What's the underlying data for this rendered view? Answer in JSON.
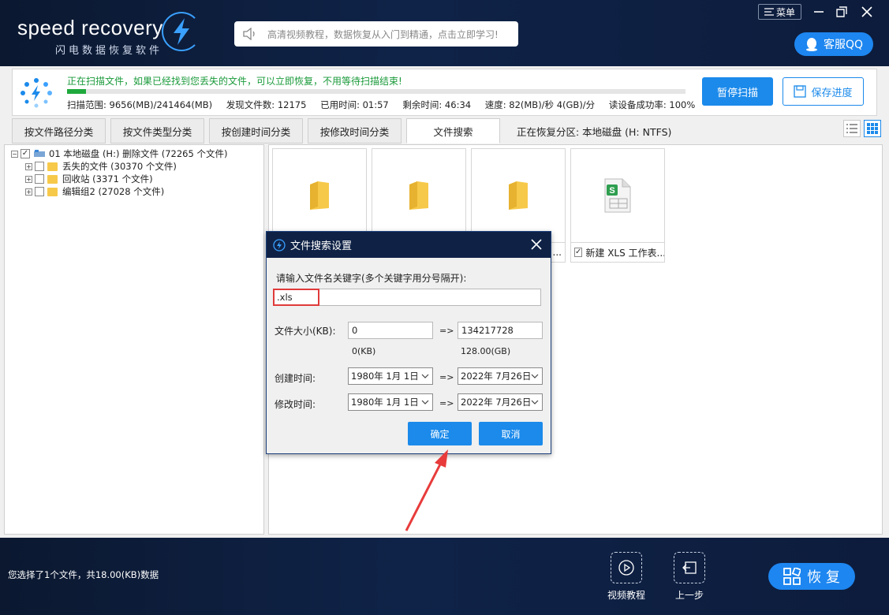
{
  "header": {
    "logo_text": "speed recovery",
    "logo_subtitle": "闪电数据恢复软件",
    "promo_text": "高清视频教程，数据恢复从入门到精通，点击立即学习!",
    "menu_label": "菜单",
    "qq_label": "客服QQ"
  },
  "scan": {
    "status_text": "正在扫描文件，如果已经找到您丢失的文件，可以立即恢复，不用等待扫描结束!",
    "progress_fraction": 0.03,
    "range": "扫描范围: 9656(MB)/241464(MB)",
    "found": "发现文件数: 12175",
    "elapsed": "已用时间: 01:57",
    "remaining": "剩余时间: 46:34",
    "speed": "速度: 82(MB)/秒  4(GB)/分",
    "success_rate": "读设备成功率: 100%",
    "pause_label": "暂停扫描",
    "save_label": "保存进度"
  },
  "tabs": [
    {
      "label": "按文件路径分类",
      "active": false
    },
    {
      "label": "按文件类型分类",
      "active": false
    },
    {
      "label": "按创建时间分类",
      "active": false
    },
    {
      "label": "按修改时间分类",
      "active": false
    },
    {
      "label": "文件搜索",
      "active": true
    }
  ],
  "partition_label": "正在恢复分区: 本地磁盘 (H: NTFS)",
  "tree": {
    "root": "01 本地磁盘 (H:) 删除文件  (72265 个文件)",
    "children": [
      "丢失的文件    (30370 个文件)",
      "回收站    (3371 个文件)",
      "编辑组2    (27028 个文件)"
    ]
  },
  "tiles": [
    {
      "type": "folder-icon",
      "label": ""
    },
    {
      "type": "folder-icon",
      "label": ""
    },
    {
      "type": "folder-icon",
      "label": "..."
    },
    {
      "type": "xls-file-icon",
      "label": "新建 XLS 工作表...",
      "checked": true
    }
  ],
  "dialog": {
    "title": "文件搜索设置",
    "keyword_label": "请输入文件名关键字(多个关键字用分号隔开):",
    "keyword_value": ".xls",
    "size_label": "文件大小(KB):",
    "size_min": "0",
    "size_max": "134217728",
    "size_min_hint": "0(KB)",
    "size_max_hint": "128.00(GB)",
    "arrow": "=>",
    "created_label": "创建时间:",
    "created_from": "1980年  1月  1日",
    "created_to": "2022年  7月26日",
    "modified_label": "修改时间:",
    "modified_from": "1980年  1月  1日",
    "modified_to": "2022年  7月26日",
    "ok_label": "确定",
    "cancel_label": "取消"
  },
  "footer": {
    "selection_info": "您选择了1个文件，共18.00(KB)数据",
    "video_label": "视频教程",
    "back_label": "上一步",
    "recover_label": "恢 复"
  },
  "colors": {
    "accent": "#1b8aeb",
    "header_bg": "#0f2348",
    "progress": "#1fa93c",
    "highlight": "#e03a3a"
  }
}
